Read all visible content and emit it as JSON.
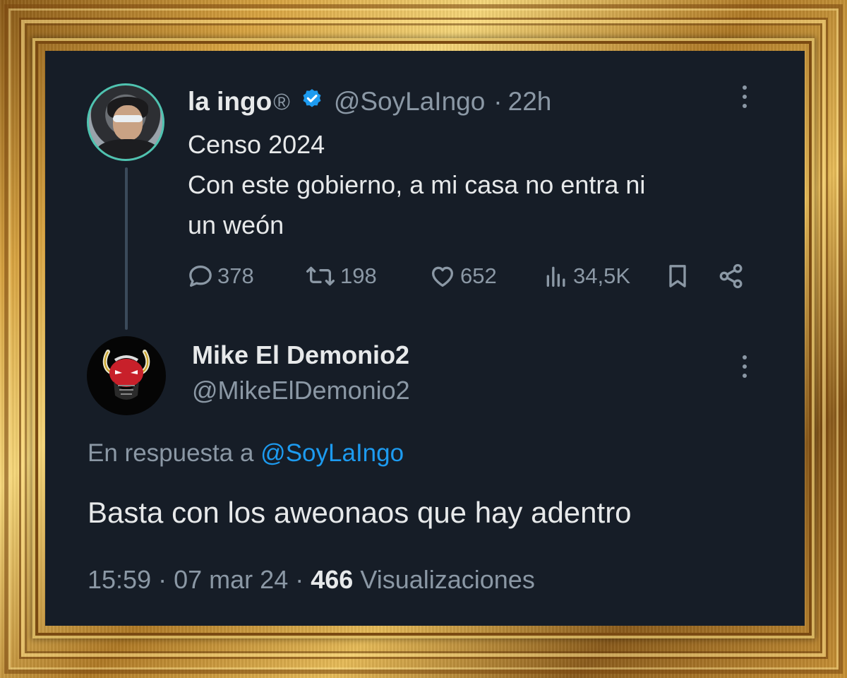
{
  "parent_tweet": {
    "display_name": "la ingo",
    "registered_mark": "®",
    "handle": "@SoyLaIngo",
    "separator": "·",
    "time_ago": "22h",
    "text_lines": [
      "Censo 2024",
      "Con este gobierno, a mi casa no entra ni",
      "un weón"
    ],
    "actions": {
      "replies": "378",
      "retweets": "198",
      "likes": "652",
      "views": "34,5K"
    },
    "verified_color": "#1d9bf0"
  },
  "reply_tweet": {
    "display_name": "Mike El Demonio2",
    "handle": "@MikeElDemonio2",
    "in_reply_prefix": "En respuesta a",
    "in_reply_mention": "@SoyLaIngo",
    "text": "Basta con los aweonaos que hay adentro",
    "time": "15:59",
    "date": "07 mar 24",
    "separator": "·",
    "view_count": "466",
    "views_label": "Visualizaciones"
  },
  "icons": [
    "more-icon",
    "verified-badge-icon",
    "reply-icon",
    "retweet-icon",
    "like-icon",
    "views-icon",
    "bookmark-icon",
    "share-icon"
  ],
  "colors": {
    "background": "#161d27",
    "text_primary": "#e7e9ea",
    "text_secondary": "#8b98a5",
    "accent": "#1d9bf0",
    "frame": "#d9a441"
  }
}
